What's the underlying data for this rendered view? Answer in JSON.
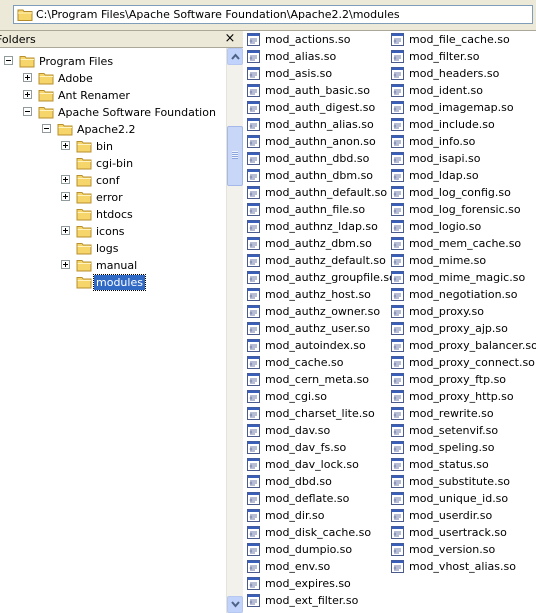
{
  "address": {
    "path": "C:\\Program Files\\Apache Software Foundation\\Apache2.2\\modules"
  },
  "panel": {
    "title": "Folders",
    "close_glyph": "×"
  },
  "tree": [
    {
      "label": "Program Files",
      "expander": "minus",
      "level": 0
    },
    {
      "label": "Adobe",
      "expander": "plus",
      "level": 1
    },
    {
      "label": "Ant Renamer",
      "expander": "plus",
      "level": 1
    },
    {
      "label": "Apache Software Foundation",
      "expander": "minus",
      "level": 1
    },
    {
      "label": "Apache2.2",
      "expander": "minus",
      "level": 2
    },
    {
      "label": "bin",
      "expander": "plus",
      "level": 3
    },
    {
      "label": "cgi-bin",
      "expander": "none",
      "level": 3
    },
    {
      "label": "conf",
      "expander": "plus",
      "level": 3
    },
    {
      "label": "error",
      "expander": "plus",
      "level": 3
    },
    {
      "label": "htdocs",
      "expander": "none",
      "level": 3
    },
    {
      "label": "icons",
      "expander": "plus",
      "level": 3
    },
    {
      "label": "logs",
      "expander": "none",
      "level": 3
    },
    {
      "label": "manual",
      "expander": "plus",
      "level": 3
    },
    {
      "label": "modules",
      "expander": "none",
      "level": 3,
      "selected": true
    }
  ],
  "files_col1": [
    "mod_actions.so",
    "mod_alias.so",
    "mod_asis.so",
    "mod_auth_basic.so",
    "mod_auth_digest.so",
    "mod_authn_alias.so",
    "mod_authn_anon.so",
    "mod_authn_dbd.so",
    "mod_authn_dbm.so",
    "mod_authn_default.so",
    "mod_authn_file.so",
    "mod_authnz_ldap.so",
    "mod_authz_dbm.so",
    "mod_authz_default.so",
    "mod_authz_groupfile.so",
    "mod_authz_host.so",
    "mod_authz_owner.so",
    "mod_authz_user.so",
    "mod_autoindex.so",
    "mod_cache.so",
    "mod_cern_meta.so",
    "mod_cgi.so",
    "mod_charset_lite.so",
    "mod_dav.so",
    "mod_dav_fs.so",
    "mod_dav_lock.so",
    "mod_dbd.so",
    "mod_deflate.so",
    "mod_dir.so",
    "mod_disk_cache.so",
    "mod_dumpio.so",
    "mod_env.so",
    "mod_expires.so",
    "mod_ext_filter.so"
  ],
  "files_col2": [
    "mod_file_cache.so",
    "mod_filter.so",
    "mod_headers.so",
    "mod_ident.so",
    "mod_imagemap.so",
    "mod_include.so",
    "mod_info.so",
    "mod_isapi.so",
    "mod_ldap.so",
    "mod_log_config.so",
    "mod_log_forensic.so",
    "mod_logio.so",
    "mod_mem_cache.so",
    "mod_mime.so",
    "mod_mime_magic.so",
    "mod_negotiation.so",
    "mod_proxy.so",
    "mod_proxy_ajp.so",
    "mod_proxy_balancer.so",
    "mod_proxy_connect.so",
    "mod_proxy_ftp.so",
    "mod_proxy_http.so",
    "mod_rewrite.so",
    "mod_setenvif.so",
    "mod_speling.so",
    "mod_status.so",
    "mod_substitute.so",
    "mod_unique_id.so",
    "mod_userdir.so",
    "mod_usertrack.so",
    "mod_version.so",
    "mod_vhost_alias.so"
  ],
  "icons": {
    "folder": "folder-icon",
    "file": "dll-file-icon"
  },
  "colors": {
    "selection": "#316ac5",
    "folder_yellow": "#f6d56a",
    "chrome": "#ece9d8"
  }
}
